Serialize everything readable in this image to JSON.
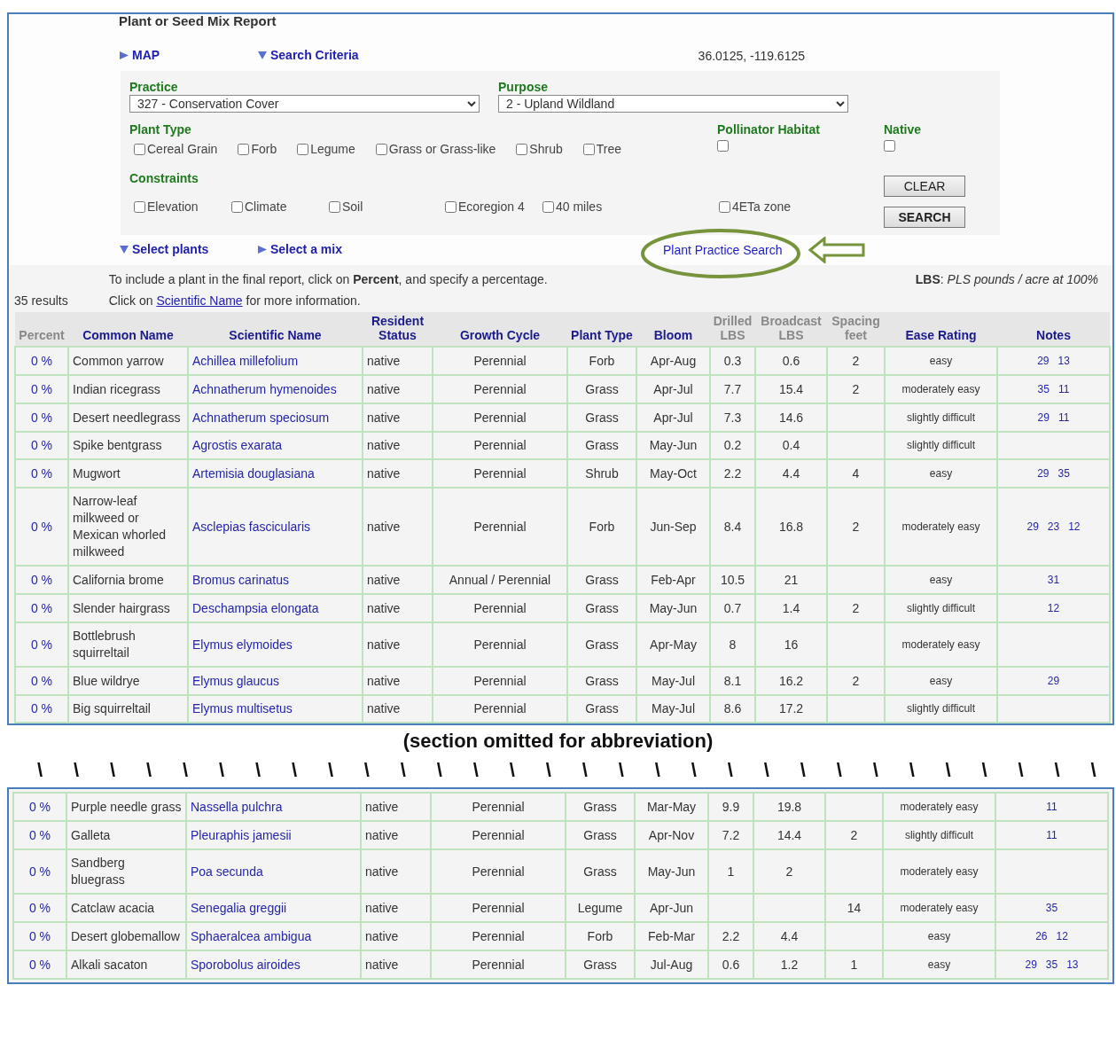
{
  "title": "Plant or Seed Mix Report",
  "top_toggles": [
    {
      "label": "MAP",
      "expanded": false
    },
    {
      "label": "Search Criteria",
      "expanded": true
    }
  ],
  "coordinates": "36.0125, -119.6125",
  "criteria": {
    "practice": {
      "label": "Practice",
      "value": "327 - Conservation Cover"
    },
    "purpose": {
      "label": "Purpose",
      "value": "2 - Upland Wildland"
    },
    "plant_type": {
      "label": "Plant Type",
      "options": [
        {
          "label": "Cereal Grain",
          "checked": false
        },
        {
          "label": "Forb",
          "checked": false
        },
        {
          "label": "Legume",
          "checked": false
        },
        {
          "label": "Grass or Grass-like",
          "checked": false
        },
        {
          "label": "Shrub",
          "checked": false
        },
        {
          "label": "Tree",
          "checked": false
        }
      ]
    },
    "pollinator_habitat": {
      "label": "Pollinator Habitat",
      "checked": false
    },
    "native": {
      "label": "Native",
      "checked": false
    },
    "constraints": {
      "label": "Constraints",
      "options": [
        {
          "label": "Elevation",
          "checked": false
        },
        {
          "label": "Climate",
          "checked": false
        },
        {
          "label": "Soil",
          "checked": false
        },
        {
          "label": "Ecoregion 4",
          "checked": false
        },
        {
          "label": "40 miles",
          "checked": false
        },
        {
          "label": "4ETa zone",
          "checked": false
        }
      ]
    },
    "buttons": [
      {
        "label": "CLEAR",
        "kind": "reset"
      },
      {
        "label": "SEARCH",
        "kind": "submit"
      }
    ]
  },
  "bottom_toggles": [
    {
      "label": "Select plants",
      "expanded": true
    },
    {
      "label": "Select a mix",
      "expanded": false
    }
  ],
  "plant_practice_link": "Plant Practice Search",
  "results_count": "35 results",
  "instruction": "To include a plant in the final report, click on **Percent**, and specify a percentage.",
  "info_line": {
    "before": "Click on",
    "link": "Scientific Name",
    "after": "for more information."
  },
  "legend": "**LBS**: *PLS pounds / acre at 100%*",
  "columns": [
    {
      "label": "Percent",
      "sortable": false
    },
    {
      "label": "Common Name",
      "sortable": true
    },
    {
      "label": "Scientific Name",
      "sortable": true
    },
    {
      "label": "Resident Status",
      "sortable": true
    },
    {
      "label": "Growth Cycle",
      "sortable": true
    },
    {
      "label": "Plant Type",
      "sortable": true
    },
    {
      "label": "Bloom",
      "sortable": true
    },
    {
      "label": "Drilled LBS",
      "sortable": false
    },
    {
      "label": "Broadcast LBS",
      "sortable": false
    },
    {
      "label": "Spacing feet",
      "sortable": false
    },
    {
      "label": "Ease Rating",
      "sortable": true
    },
    {
      "label": "Notes",
      "sortable": true
    }
  ],
  "rows": [
    {
      "percent": "0 %",
      "common": "Common yarrow",
      "scientific": "Achillea millefolium",
      "resident": "native",
      "growth": "Perennial",
      "type": "Forb",
      "bloom": "Apr-Aug",
      "drilled": "0.3",
      "broadcast": "0.6",
      "spacing": "2",
      "ease": "easy",
      "notes": [
        "29",
        "13"
      ]
    },
    {
      "percent": "0 %",
      "common": "Indian ricegrass",
      "scientific": "Achnatherum hymenoides",
      "resident": "native",
      "growth": "Perennial",
      "type": "Grass",
      "bloom": "Apr-Jul",
      "drilled": "7.7",
      "broadcast": "15.4",
      "spacing": "2",
      "ease": "moderately easy",
      "notes": [
        "35",
        "11"
      ]
    },
    {
      "percent": "0 %",
      "common": "Desert needlegrass",
      "scientific": "Achnatherum speciosum",
      "resident": "native",
      "growth": "Perennial",
      "type": "Grass",
      "bloom": "Apr-Jul",
      "drilled": "7.3",
      "broadcast": "14.6",
      "ease": "slightly difficult",
      "notes": [
        "29",
        "11"
      ]
    },
    {
      "percent": "0 %",
      "common": "Spike bentgrass",
      "scientific": "Agrostis exarata",
      "resident": "native",
      "growth": "Perennial",
      "type": "Grass",
      "bloom": "May-Jun",
      "drilled": "0.2",
      "broadcast": "0.4",
      "ease": "slightly difficult"
    },
    {
      "percent": "0 %",
      "common": "Mugwort",
      "scientific": "Artemisia douglasiana",
      "resident": "native",
      "growth": "Perennial",
      "type": "Shrub",
      "bloom": "May-Oct",
      "drilled": "2.2",
      "broadcast": "4.4",
      "spacing": "4",
      "ease": "easy",
      "notes": [
        "29",
        "35"
      ]
    },
    {
      "percent": "0 %",
      "common": "Narrow-leaf milkweed or Mexican whorled milkweed",
      "scientific": "Asclepias fascicularis",
      "resident": "native",
      "growth": "Perennial",
      "type": "Forb",
      "bloom": "Jun-Sep",
      "drilled": "8.4",
      "broadcast": "16.8",
      "spacing": "2",
      "ease": "moderately easy",
      "notes": [
        "29",
        "23",
        "12"
      ]
    },
    {
      "percent": "0 %",
      "common": "California brome",
      "scientific": "Bromus carinatus",
      "resident": "native",
      "growth": "Annual / Perennial",
      "type": "Grass",
      "bloom": "Feb-Apr",
      "drilled": "10.5",
      "broadcast": "21",
      "ease": "easy",
      "notes": [
        "31"
      ]
    },
    {
      "percent": "0 %",
      "common": "Slender hairgrass",
      "scientific": "Deschampsia elongata",
      "resident": "native",
      "growth": "Perennial",
      "type": "Grass",
      "bloom": "May-Jun",
      "drilled": "0.7",
      "broadcast": "1.4",
      "spacing": "2",
      "ease": "slightly difficult",
      "notes": [
        "12"
      ]
    },
    {
      "percent": "0 %",
      "common": "Bottlebrush squirreltail",
      "scientific": "Elymus elymoides",
      "resident": "native",
      "growth": "Perennial",
      "type": "Grass",
      "bloom": "Apr-May",
      "drilled": "8",
      "broadcast": "16",
      "ease": "moderately easy"
    },
    {
      "percent": "0 %",
      "common": "Blue wildrye",
      "scientific": "Elymus glaucus",
      "resident": "native",
      "growth": "Perennial",
      "type": "Grass",
      "bloom": "May-Jul",
      "drilled": "8.1",
      "broadcast": "16.2",
      "spacing": "2",
      "ease": "easy",
      "notes": [
        "29"
      ]
    },
    {
      "percent": "0 %",
      "common": "Big squirreltail",
      "scientific": "Elymus multisetus",
      "resident": "native",
      "growth": "Perennial",
      "type": "Grass",
      "bloom": "May-Jul",
      "drilled": "8.6",
      "broadcast": "17.2",
      "ease": "slightly difficult"
    }
  ],
  "omission_caption": "(section omitted for abbreviation)",
  "omission_marks": [
    "\\",
    "\\",
    "\\",
    "\\",
    "\\",
    "\\",
    "\\",
    "\\",
    "\\",
    "\\",
    "\\",
    "\\",
    "\\",
    "\\",
    "\\",
    "\\",
    "\\",
    "\\",
    "\\",
    "\\",
    "\\",
    "\\",
    "\\",
    "\\",
    "\\",
    "\\",
    "\\",
    "\\",
    "\\",
    "\\"
  ],
  "continued_rows": [
    {
      "percent": "0 %",
      "common": "Purple needle grass",
      "scientific": "Nassella pulchra",
      "resident": "native",
      "growth": "Perennial",
      "type": "Grass",
      "bloom": "Mar-May",
      "drilled": "9.9",
      "broadcast": "19.8",
      "ease": "moderately easy",
      "notes": [
        "11"
      ]
    },
    {
      "percent": "0 %",
      "common": "Galleta",
      "scientific": "Pleuraphis jamesii",
      "resident": "native",
      "growth": "Perennial",
      "type": "Grass",
      "bloom": "Apr-Nov",
      "drilled": "7.2",
      "broadcast": "14.4",
      "spacing": "2",
      "ease": "slightly difficult",
      "notes": [
        "11"
      ]
    },
    {
      "percent": "0 %",
      "common": "Sandberg bluegrass",
      "scientific": "Poa secunda",
      "resident": "native",
      "growth": "Perennial",
      "type": "Grass",
      "bloom": "May-Jun",
      "drilled": "1",
      "broadcast": "2",
      "ease": "moderately easy"
    },
    {
      "percent": "0 %",
      "common": "Catclaw acacia",
      "scientific": "Senegalia greggii",
      "resident": "native",
      "growth": "Perennial",
      "type": "Legume",
      "bloom": "Apr-Jun",
      "spacing": "14",
      "ease": "moderately easy",
      "notes": [
        "35"
      ]
    },
    {
      "percent": "0 %",
      "common": "Desert globemallow",
      "scientific": "Sphaeralcea ambigua",
      "resident": "native",
      "growth": "Perennial",
      "type": "Forb",
      "bloom": "Feb-Mar",
      "drilled": "2.2",
      "broadcast": "4.4",
      "ease": "easy",
      "notes": [
        "26",
        "12"
      ]
    },
    {
      "percent": "0 %",
      "common": "Alkali sacaton",
      "scientific": "Sporobolus airoides",
      "resident": "native",
      "growth": "Perennial",
      "type": "Grass",
      "bloom": "Jul-Aug",
      "drilled": "0.6",
      "broadcast": "1.2",
      "spacing": "1",
      "ease": "easy",
      "notes": [
        "29",
        "35",
        "13"
      ]
    }
  ]
}
